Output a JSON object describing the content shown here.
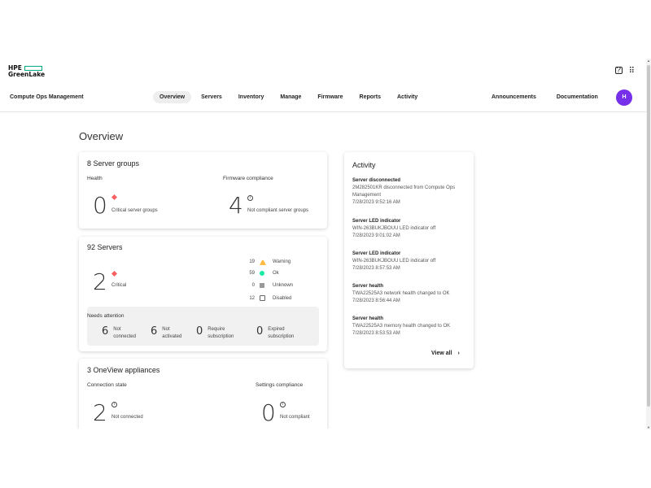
{
  "logo": {
    "line1": "HPE",
    "line2": "GreenLake"
  },
  "topbar_icons": {
    "help": "?",
    "apps": "⠿"
  },
  "nav": {
    "app_name": "Compute Ops Management",
    "tabs": [
      "Overview",
      "Servers",
      "Inventory",
      "Manage",
      "Firmware",
      "Reports",
      "Activity"
    ],
    "active_tab": "Overview",
    "announcements": "Announcements",
    "documentation": "Documentation",
    "avatar_initial": "H"
  },
  "page_title": "Overview",
  "server_groups": {
    "title": "8 Server groups",
    "health_label": "Health",
    "health_count": "0",
    "health_text": "Critical server groups",
    "fw_label": "Firmware compliance",
    "fw_count": "4",
    "fw_text": "Not compliant server groups"
  },
  "servers": {
    "title": "92 Servers",
    "critical_count": "2",
    "critical_text": "Critical",
    "statuses": [
      {
        "count": "19",
        "label": "Warning"
      },
      {
        "count": "59",
        "label": "Ok"
      },
      {
        "count": "0",
        "label": "Unknown"
      },
      {
        "count": "12",
        "label": "Disabled"
      }
    ],
    "attention_title": "Needs attention",
    "attention": [
      {
        "count": "6",
        "line1": "Not",
        "line2": "connected"
      },
      {
        "count": "6",
        "line1": "Not",
        "line2": "activated"
      },
      {
        "count": "0",
        "line1": "Require",
        "line2": "subscription"
      },
      {
        "count": "0",
        "line1": "Expired",
        "line2": "subscription"
      }
    ]
  },
  "oneview": {
    "title": "3 OneView appliances",
    "conn_label": "Connection state",
    "conn_count": "2",
    "conn_text": "Not connected",
    "settings_label": "Settings compliance",
    "settings_count": "0",
    "settings_text": "Not compliant"
  },
  "activity": {
    "title": "Activity",
    "items": [
      {
        "title": "Server disconnected",
        "desc": "2M282501KR disconnected from Compute Ops Management",
        "time": "7/28/2023 9:52:16 AM"
      },
      {
        "title": "Server LED indicator",
        "desc": "WIN-263BUKJBOUU LED indicator off",
        "time": "7/28/2023 9:01:02 AM"
      },
      {
        "title": "Server LED indicator",
        "desc": "WIN-263BUKJBOUU LED indicator off",
        "time": "7/28/2023 8:57:53 AM"
      },
      {
        "title": "Server health",
        "desc": "TWA22525A3 network health changed to OK",
        "time": "7/28/2023 8:56:44 AM"
      },
      {
        "title": "Server health",
        "desc": "TWA22525A3 memory health changed to OK",
        "time": "7/28/2023 8:53:53 AM"
      }
    ],
    "view_all": "View all"
  },
  "colors": {
    "brand": "#01a982",
    "avatar": "#7630ea",
    "critical": "#fc6161",
    "warning": "#ffbc44",
    "ok": "#17eba0"
  }
}
